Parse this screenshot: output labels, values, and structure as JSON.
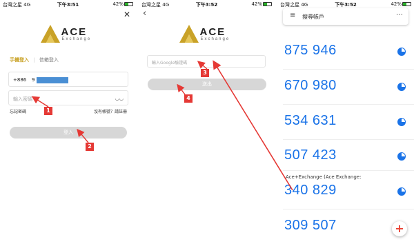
{
  "status_left": "台灣之星",
  "network": "4G",
  "battery": "42%",
  "battery_fill": 0.42,
  "times": [
    "下午3:51",
    "下午3:52",
    "下午3:52"
  ],
  "logo": {
    "word": "ACE",
    "sub": "Exchange"
  },
  "login": {
    "tab_phone": "手機登入",
    "tab_email": "信箱登入",
    "country_code": "+886",
    "phone_prefix": "9",
    "password_placeholder": "輸入密碼",
    "forgot": "忘記密碼",
    "register": "沒有帳號？請註冊",
    "login_button": "登入"
  },
  "verify": {
    "google_placeholder": "輸入Google驗證碼",
    "logout_button": "送出"
  },
  "authenticator": {
    "search_placeholder": "搜尋帳戶",
    "codes": [
      "875 946",
      "670 980",
      "534 631",
      "507 423",
      "340 829",
      "309 507"
    ],
    "account_label": "Ace+Exchange (Ace Exchange:"
  },
  "markers": [
    "1",
    "2",
    "3",
    "4"
  ],
  "colors": {
    "accent": "#c9a227",
    "code": "#1a73e8",
    "marker": "#e53935",
    "arrow": "#e53935"
  }
}
